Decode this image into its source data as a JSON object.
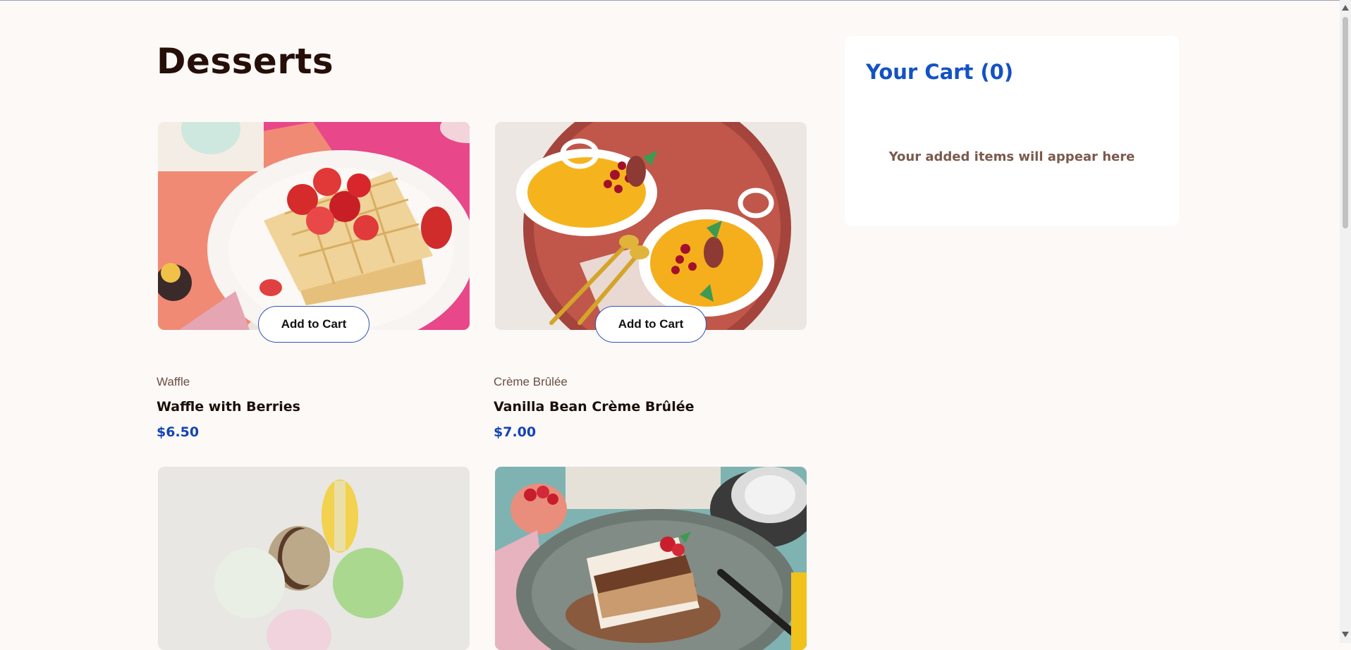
{
  "page": {
    "title": "Desserts"
  },
  "products": [
    {
      "category": "Waffle",
      "name": "Waffle with Berries",
      "price": "$6.50",
      "button_label": "Add to Cart",
      "image": "waffle-photo"
    },
    {
      "category": "Crème Brûlée",
      "name": "Vanilla Bean Crème Brûlée",
      "price": "$7.00",
      "button_label": "Add to Cart",
      "image": "creme-brulee-photo"
    },
    {
      "image": "macaron-photo"
    },
    {
      "image": "tiramisu-photo"
    }
  ],
  "cart": {
    "title": "Your Cart (0)",
    "empty_message": "Your added items will appear here"
  },
  "colors": {
    "background": "#fcf9f6",
    "accent": "#1452c4",
    "price": "#1444b6",
    "heading": "#260f08"
  }
}
